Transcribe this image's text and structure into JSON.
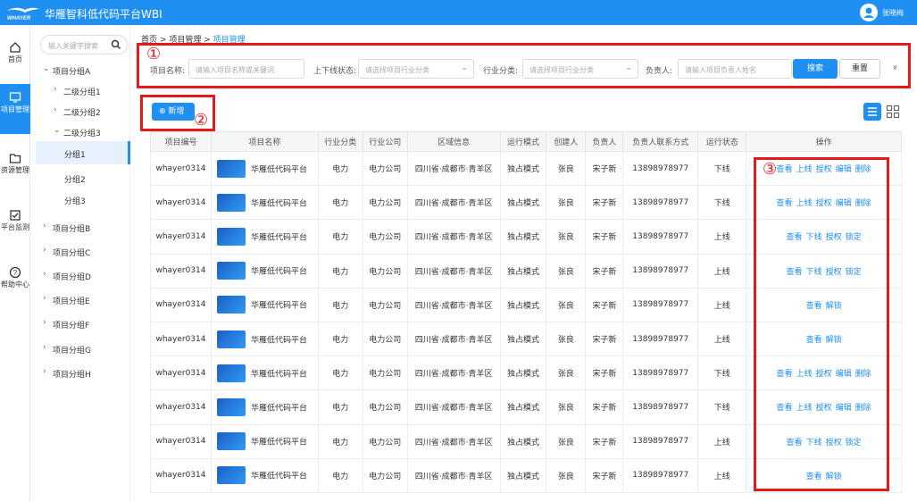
{
  "app": {
    "title": "华雁智科低代码平台WBI",
    "logo_text": "WHAYER",
    "user_name": "张晓梅"
  },
  "leftnav": [
    {
      "label": "首页",
      "icon": "home-icon"
    },
    {
      "label": "项目管理",
      "icon": "monitor-icon",
      "active": true
    },
    {
      "label": "资源管理",
      "icon": "folder-icon"
    },
    {
      "label": "平台监测",
      "icon": "checkbox-icon"
    },
    {
      "label": "帮助中心",
      "icon": "help-icon"
    }
  ],
  "tree": {
    "search_placeholder": "输入关键字搜索",
    "items": [
      {
        "label": "项目分组A",
        "arrow": "⌄",
        "level": 0
      },
      {
        "label": "二级分组1",
        "arrow": "›",
        "level": 1
      },
      {
        "label": "二级分组2",
        "arrow": "›",
        "level": 1
      },
      {
        "label": "二级分组3",
        "arrow": "⌄",
        "level": 1
      },
      {
        "label": "分组1",
        "arrow": "",
        "level": 2,
        "active": true
      },
      {
        "label": "分组2",
        "arrow": "",
        "level": 2
      },
      {
        "label": "分组3",
        "arrow": "",
        "level": 2
      },
      {
        "label": "项目分组B",
        "arrow": "›",
        "level": 0
      },
      {
        "label": "项目分组C",
        "arrow": "›",
        "level": 0
      },
      {
        "label": "项目分组D",
        "arrow": "›",
        "level": 0
      },
      {
        "label": "项目分组E",
        "arrow": "›",
        "level": 0
      },
      {
        "label": "项目分组F",
        "arrow": "›",
        "level": 0
      },
      {
        "label": "项目分组G",
        "arrow": "›",
        "level": 0
      },
      {
        "label": "项目分组H",
        "arrow": "›",
        "level": 0
      }
    ]
  },
  "breadcrumb": {
    "home": "首页",
    "sep": ">",
    "parent": "项目管理",
    "current": "项目管理"
  },
  "filter": {
    "name_label": "项目名称:",
    "name_placeholder": "请输入项目名称或关键词",
    "status_label": "上下线状态:",
    "status_placeholder": "请选择项目行业分类",
    "industry_label": "行业分类:",
    "industry_placeholder": "请选择项目行业分类",
    "owner_label": "负责人:",
    "owner_placeholder": "请输入项目负责人姓名",
    "search_btn": "搜索",
    "reset_btn": "重置",
    "expand": "»"
  },
  "annotations": {
    "n1": "①",
    "n2": "②",
    "n3": "③",
    "color": "#e3191b"
  },
  "toolbar": {
    "add_label": "新增"
  },
  "table": {
    "headers": [
      "项目编号",
      "项目名称",
      "行业分类",
      "行业公司",
      "区域信息",
      "运行模式",
      "创建人",
      "负责人",
      "负责人联系方式",
      "运行状态",
      "操作"
    ],
    "rows": [
      {
        "id": "whayer0314",
        "name": "华雁低代码平台",
        "industry": "电力",
        "company": "电力公司",
        "region": "四川省·成都市·青羊区",
        "mode": "独占模式",
        "creator": "张良",
        "owner": "宋子新",
        "phone": "13898978977",
        "status": "下线",
        "status_type": "off",
        "ops": [
          "查看",
          "上线",
          "授权",
          "编辑",
          "删除"
        ]
      },
      {
        "id": "whayer0314",
        "name": "华雁低代码平台",
        "industry": "电力",
        "company": "电力公司",
        "region": "四川省·成都市·青羊区",
        "mode": "独占模式",
        "creator": "张良",
        "owner": "宋子新",
        "phone": "13898978977",
        "status": "下线",
        "status_type": "off",
        "ops": [
          "查看",
          "上线",
          "授权",
          "编辑",
          "删除"
        ]
      },
      {
        "id": "whayer0314",
        "name": "华雁低代码平台",
        "industry": "电力",
        "company": "电力公司",
        "region": "四川省·成都市·青羊区",
        "mode": "独占模式",
        "creator": "张良",
        "owner": "宋子新",
        "phone": "13898978977",
        "status": "上线",
        "status_type": "on",
        "ops": [
          "查看",
          "下线",
          "授权",
          "锁定"
        ]
      },
      {
        "id": "whayer0314",
        "name": "华雁低代码平台",
        "industry": "电力",
        "company": "电力公司",
        "region": "四川省·成都市·青羊区",
        "mode": "独占模式",
        "creator": "张良",
        "owner": "宋子新",
        "phone": "13898978977",
        "status": "上线",
        "status_type": "on",
        "ops": [
          "查看",
          "下线",
          "授权",
          "锁定"
        ]
      },
      {
        "id": "whayer0314",
        "name": "华雁低代码平台",
        "industry": "电力",
        "company": "电力公司",
        "region": "四川省·成都市·青羊区",
        "mode": "独占模式",
        "creator": "张良",
        "owner": "宋子新",
        "phone": "13898978977",
        "status": "上线",
        "status_type": "on",
        "ops": [
          "查看",
          "解锁"
        ]
      },
      {
        "id": "whayer0314",
        "name": "华雁低代码平台",
        "industry": "电力",
        "company": "电力公司",
        "region": "四川省·成都市·青羊区",
        "mode": "独占模式",
        "creator": "张良",
        "owner": "宋子新",
        "phone": "13898978977",
        "status": "上线",
        "status_type": "on",
        "ops": [
          "查看",
          "解锁"
        ]
      },
      {
        "id": "whayer0314",
        "name": "华雁低代码平台",
        "industry": "电力",
        "company": "电力公司",
        "region": "四川省·成都市·青羊区",
        "mode": "独占模式",
        "creator": "张良",
        "owner": "宋子新",
        "phone": "13898978977",
        "status": "下线",
        "status_type": "off",
        "ops": [
          "查看",
          "上线",
          "授权",
          "编辑",
          "删除"
        ]
      },
      {
        "id": "whayer0314",
        "name": "华雁低代码平台",
        "industry": "电力",
        "company": "电力公司",
        "region": "四川省·成都市·青羊区",
        "mode": "独占模式",
        "creator": "张良",
        "owner": "宋子新",
        "phone": "13898978977",
        "status": "下线",
        "status_type": "off",
        "ops": [
          "查看",
          "上线",
          "授权",
          "编辑",
          "删除"
        ]
      },
      {
        "id": "whayer0314",
        "name": "华雁低代码平台",
        "industry": "电力",
        "company": "电力公司",
        "region": "四川省·成都市·青羊区",
        "mode": "独占模式",
        "creator": "张良",
        "owner": "宋子新",
        "phone": "13898978977",
        "status": "上线",
        "status_type": "on",
        "ops": [
          "查看",
          "下线",
          "授权",
          "锁定"
        ]
      },
      {
        "id": "whayer0314",
        "name": "华雁低代码平台",
        "industry": "电力",
        "company": "电力公司",
        "region": "四川省·成都市·青羊区",
        "mode": "独占模式",
        "creator": "张良",
        "owner": "宋子新",
        "phone": "13898978977",
        "status": "上线",
        "status_type": "on",
        "ops": [
          "查看",
          "解锁"
        ]
      }
    ]
  },
  "colors": {
    "primary": "#1f8ff2",
    "online": "#52c41a",
    "annotation": "#e3191b"
  }
}
